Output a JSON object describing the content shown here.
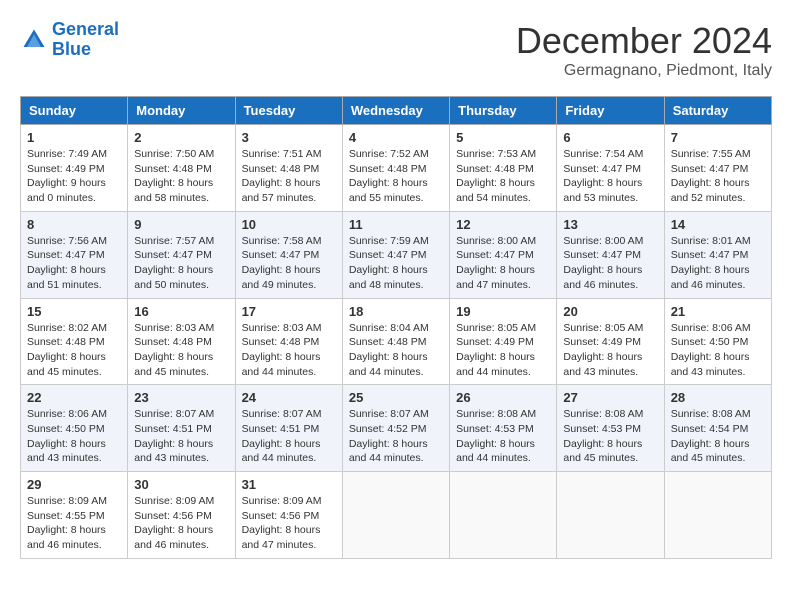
{
  "header": {
    "logo_line1": "General",
    "logo_line2": "Blue",
    "month_year": "December 2024",
    "location": "Germagnano, Piedmont, Italy"
  },
  "days_of_week": [
    "Sunday",
    "Monday",
    "Tuesday",
    "Wednesday",
    "Thursday",
    "Friday",
    "Saturday"
  ],
  "weeks": [
    [
      {
        "day": "1",
        "sunrise": "7:49 AM",
        "sunset": "4:49 PM",
        "daylight": "9 hours and 0 minutes."
      },
      {
        "day": "2",
        "sunrise": "7:50 AM",
        "sunset": "4:48 PM",
        "daylight": "8 hours and 58 minutes."
      },
      {
        "day": "3",
        "sunrise": "7:51 AM",
        "sunset": "4:48 PM",
        "daylight": "8 hours and 57 minutes."
      },
      {
        "day": "4",
        "sunrise": "7:52 AM",
        "sunset": "4:48 PM",
        "daylight": "8 hours and 55 minutes."
      },
      {
        "day": "5",
        "sunrise": "7:53 AM",
        "sunset": "4:48 PM",
        "daylight": "8 hours and 54 minutes."
      },
      {
        "day": "6",
        "sunrise": "7:54 AM",
        "sunset": "4:47 PM",
        "daylight": "8 hours and 53 minutes."
      },
      {
        "day": "7",
        "sunrise": "7:55 AM",
        "sunset": "4:47 PM",
        "daylight": "8 hours and 52 minutes."
      }
    ],
    [
      {
        "day": "8",
        "sunrise": "7:56 AM",
        "sunset": "4:47 PM",
        "daylight": "8 hours and 51 minutes."
      },
      {
        "day": "9",
        "sunrise": "7:57 AM",
        "sunset": "4:47 PM",
        "daylight": "8 hours and 50 minutes."
      },
      {
        "day": "10",
        "sunrise": "7:58 AM",
        "sunset": "4:47 PM",
        "daylight": "8 hours and 49 minutes."
      },
      {
        "day": "11",
        "sunrise": "7:59 AM",
        "sunset": "4:47 PM",
        "daylight": "8 hours and 48 minutes."
      },
      {
        "day": "12",
        "sunrise": "8:00 AM",
        "sunset": "4:47 PM",
        "daylight": "8 hours and 47 minutes."
      },
      {
        "day": "13",
        "sunrise": "8:00 AM",
        "sunset": "4:47 PM",
        "daylight": "8 hours and 46 minutes."
      },
      {
        "day": "14",
        "sunrise": "8:01 AM",
        "sunset": "4:47 PM",
        "daylight": "8 hours and 46 minutes."
      }
    ],
    [
      {
        "day": "15",
        "sunrise": "8:02 AM",
        "sunset": "4:48 PM",
        "daylight": "8 hours and 45 minutes."
      },
      {
        "day": "16",
        "sunrise": "8:03 AM",
        "sunset": "4:48 PM",
        "daylight": "8 hours and 45 minutes."
      },
      {
        "day": "17",
        "sunrise": "8:03 AM",
        "sunset": "4:48 PM",
        "daylight": "8 hours and 44 minutes."
      },
      {
        "day": "18",
        "sunrise": "8:04 AM",
        "sunset": "4:48 PM",
        "daylight": "8 hours and 44 minutes."
      },
      {
        "day": "19",
        "sunrise": "8:05 AM",
        "sunset": "4:49 PM",
        "daylight": "8 hours and 44 minutes."
      },
      {
        "day": "20",
        "sunrise": "8:05 AM",
        "sunset": "4:49 PM",
        "daylight": "8 hours and 43 minutes."
      },
      {
        "day": "21",
        "sunrise": "8:06 AM",
        "sunset": "4:50 PM",
        "daylight": "8 hours and 43 minutes."
      }
    ],
    [
      {
        "day": "22",
        "sunrise": "8:06 AM",
        "sunset": "4:50 PM",
        "daylight": "8 hours and 43 minutes."
      },
      {
        "day": "23",
        "sunrise": "8:07 AM",
        "sunset": "4:51 PM",
        "daylight": "8 hours and 43 minutes."
      },
      {
        "day": "24",
        "sunrise": "8:07 AM",
        "sunset": "4:51 PM",
        "daylight": "8 hours and 44 minutes."
      },
      {
        "day": "25",
        "sunrise": "8:07 AM",
        "sunset": "4:52 PM",
        "daylight": "8 hours and 44 minutes."
      },
      {
        "day": "26",
        "sunrise": "8:08 AM",
        "sunset": "4:53 PM",
        "daylight": "8 hours and 44 minutes."
      },
      {
        "day": "27",
        "sunrise": "8:08 AM",
        "sunset": "4:53 PM",
        "daylight": "8 hours and 45 minutes."
      },
      {
        "day": "28",
        "sunrise": "8:08 AM",
        "sunset": "4:54 PM",
        "daylight": "8 hours and 45 minutes."
      }
    ],
    [
      {
        "day": "29",
        "sunrise": "8:09 AM",
        "sunset": "4:55 PM",
        "daylight": "8 hours and 46 minutes."
      },
      {
        "day": "30",
        "sunrise": "8:09 AM",
        "sunset": "4:56 PM",
        "daylight": "8 hours and 46 minutes."
      },
      {
        "day": "31",
        "sunrise": "8:09 AM",
        "sunset": "4:56 PM",
        "daylight": "8 hours and 47 minutes."
      },
      null,
      null,
      null,
      null
    ]
  ],
  "labels": {
    "sunrise": "Sunrise:",
    "sunset": "Sunset:",
    "daylight": "Daylight:"
  }
}
